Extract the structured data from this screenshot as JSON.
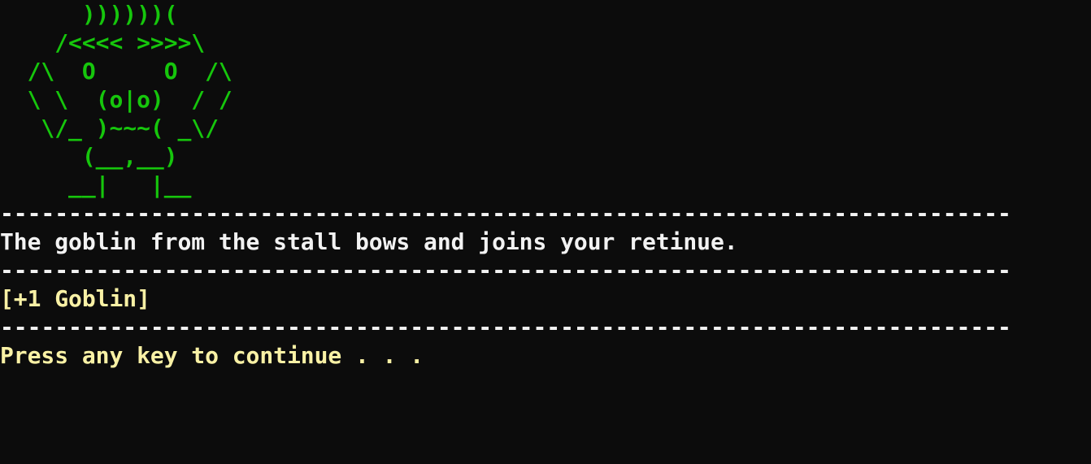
{
  "colors": {
    "background": "#0c0c0c",
    "art": "#16c60c",
    "message": "#f2f2f2",
    "reward": "#f9f1a5",
    "prompt": "#f9f1a5"
  },
  "art_lines": [
    "      ))))))(",
    "    /<<<< >>>>\\",
    "  /\\  O     O  /\\",
    "  \\ \\  (o|o)  / /",
    "   \\/_ )~~~( _\\/",
    "      (__,__)",
    "     __|   |__"
  ],
  "divider": "--------------------------------------------------------------------------",
  "message": "The goblin from the stall bows and joins your retinue.",
  "reward": "[+1 Goblin]",
  "prompt": "Press any key to continue . . ."
}
